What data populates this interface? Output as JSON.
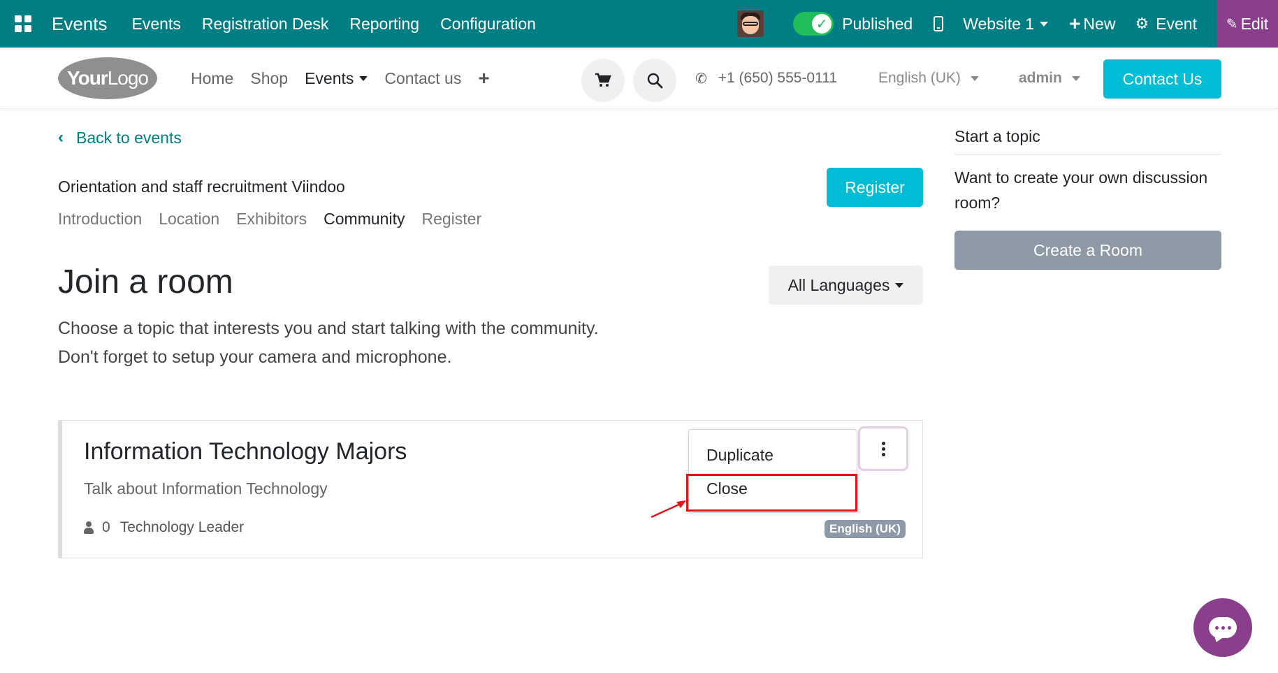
{
  "adminbar": {
    "app_name": "Events",
    "menu": [
      "Events",
      "Registration Desk",
      "Reporting",
      "Configuration"
    ],
    "published_label": "Published",
    "website_label": "Website 1",
    "new_label": "New",
    "event_label": "Event",
    "edit_label": "Edit"
  },
  "header": {
    "logo_bold": "Your",
    "logo_rest": "Logo",
    "nav": [
      "Home",
      "Shop",
      "Events",
      "Contact us"
    ],
    "phone": "+1 (650) 555-0111",
    "language": "English (UK)",
    "user": "admin",
    "contact_button": "Contact Us"
  },
  "main": {
    "back_link": "Back to events",
    "event_title": "Orientation and staff recruitment Viindoo",
    "register_button": "Register",
    "tabs": [
      "Introduction",
      "Location",
      "Exhibitors",
      "Community",
      "Register"
    ],
    "heading": "Join a room",
    "language_filter": "All Languages",
    "desc_line1": "Choose a topic that interests you and start talking with the community.",
    "desc_line2": "Don't forget to setup your camera and microphone."
  },
  "room": {
    "title": "Information Technology Majors",
    "description": "Talk about Information Technology",
    "participants": "0",
    "target": "Technology Leader",
    "language_badge": "English (UK)",
    "menu_items": [
      "Duplicate",
      "Close"
    ]
  },
  "sidebar": {
    "title": "Start a topic",
    "description": "Want to create your own discussion room?",
    "create_button": "Create a Room"
  },
  "colors": {
    "adminbar": "#017e84",
    "edit": "#8a3f8d",
    "primary": "#00bcd4",
    "highlight": "#e3131b"
  }
}
